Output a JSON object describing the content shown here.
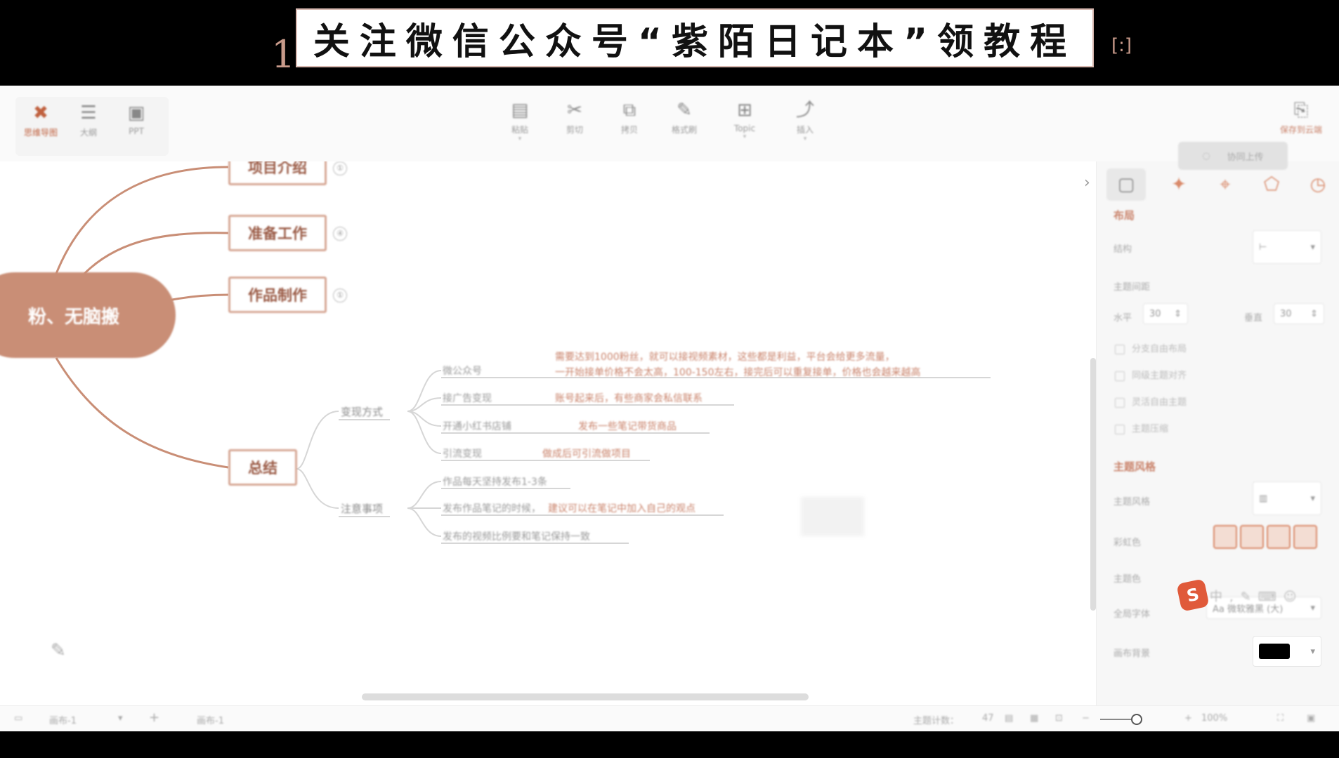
{
  "banner": {
    "number": "1",
    "text": "关注微信公众号“紫陌日记本”领教程",
    "right_glyph": "[:]"
  },
  "toolbar": {
    "left": [
      {
        "label": "思维导图",
        "icon": "mindmap-icon",
        "glyph": "✖"
      },
      {
        "label": "大纲",
        "icon": "outline-icon",
        "glyph": "☰"
      },
      {
        "label": "PPT",
        "icon": "ppt-icon",
        "glyph": "▣"
      }
    ],
    "center": [
      {
        "label": "粘贴",
        "icon": "clipboard-icon",
        "glyph": "▤",
        "caret": "▾"
      },
      {
        "label": "剪切",
        "icon": "scissors-icon",
        "glyph": "✂",
        "caret": ""
      },
      {
        "label": "拷贝",
        "icon": "copy-icon",
        "glyph": "⧉",
        "caret": ""
      },
      {
        "label": "格式刷",
        "icon": "format-brush-icon",
        "glyph": "✎",
        "caret": ""
      },
      {
        "label": "Topic",
        "icon": "topic-icon",
        "glyph": "⊞",
        "caret": "▾"
      },
      {
        "label": "插入",
        "icon": "insert-icon",
        "glyph": "⤴",
        "caret": "▾"
      }
    ],
    "right": {
      "label": "保存到云端",
      "icon": "cloud-save-icon",
      "glyph": "⎘"
    }
  },
  "mindmap": {
    "central": "粉、无脑搬",
    "branches": [
      {
        "label": "项目介绍",
        "badge": "①"
      },
      {
        "label": "准备工作",
        "badge": "④"
      },
      {
        "label": "作品制作",
        "badge": "①"
      },
      {
        "label": "总结",
        "badge": ""
      }
    ],
    "summary": {
      "monetization": {
        "label": "变现方式",
        "items": [
          {
            "label": "微公众号",
            "detail_line1": "需要达到1000粉丝，就可以接视频素材，这些都是利益，平台会给更多流量，",
            "detail_line2": "一开始接单价格不会太高，100-150左右，接完后可以重复接单，价格也会越来越高"
          },
          {
            "label": "接广告变现",
            "detail_line1": "账号起来后，有些商家会私信联系",
            "detail_line2": ""
          },
          {
            "label": "开通小红书店铺",
            "detail_line1": "发布一些笔记带货商品",
            "detail_line2": ""
          },
          {
            "label": "引流变现",
            "detail_line1": "做成后可引流做项目",
            "detail_line2": ""
          }
        ]
      },
      "notes": {
        "label": "注意事项",
        "items": [
          {
            "label": "作品每天坚持发布1-3条",
            "detail": ""
          },
          {
            "label": "发布作品笔记的时候，",
            "detail": "建议可以在笔记中加入自己的观点"
          },
          {
            "label": "发布的视频比例要和笔记保持一致",
            "detail": ""
          }
        ]
      }
    }
  },
  "panel": {
    "tabs": [
      "style-tab",
      "ai-tab",
      "marker-tab",
      "sticker-tab",
      "clock-tab"
    ],
    "collab_label": "协同上传",
    "layout_header": "布局",
    "structure_label": "结构",
    "spacing_label": "主题间距",
    "horizontal_label": "水平",
    "horizontal_value": "30",
    "vertical_label": "垂直",
    "vertical_value": "30",
    "checkboxes": [
      "分支自由布局",
      "同级主题对齐",
      "灵活自由主题",
      "主题压缩"
    ],
    "style_header": "主题风格",
    "theme_label": "主题风格",
    "skeleton_label": "彩虹色",
    "bg_label": "主题色",
    "font_label": "全局字体",
    "font_value": "Aa 微软雅黑 (大)",
    "canvas_label": "画布背景",
    "canvas_color": "#000000"
  },
  "status": {
    "sheet_name": "画布-1",
    "add_label": "+",
    "sheet_tab": "画布-1",
    "topic_count_label": "主题计数：",
    "topic_count": "47",
    "zoom": "100%"
  },
  "colors": {
    "accent": "#c9826a",
    "node_fill": "#c98e76",
    "node_border": "#d7a896"
  }
}
